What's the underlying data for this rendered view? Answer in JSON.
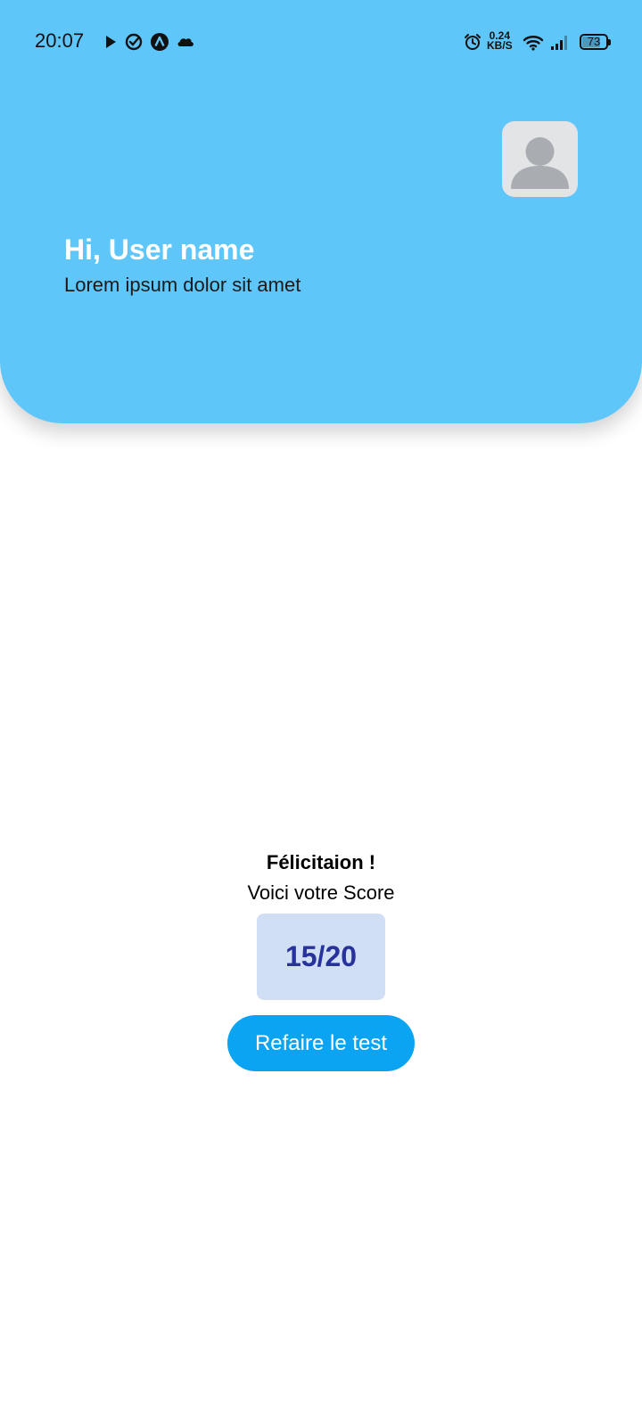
{
  "status_bar": {
    "time": "20:07",
    "network_speed_value": "0.24",
    "network_speed_unit": "KB/S",
    "battery_percent": "73",
    "battery_level": 0.73,
    "left_icons": [
      "play-icon",
      "check-circle-icon",
      "app-a-icon",
      "cloud-icon"
    ],
    "right_icons": [
      "alarm-icon",
      "wifi-icon",
      "signal-icon",
      "battery-icon"
    ]
  },
  "header": {
    "background_color": "#5fc6f9",
    "greeting": "Hi, User name",
    "subtitle": "Lorem ipsum dolor sit amet",
    "avatar_icon": "user-avatar-icon"
  },
  "result": {
    "title": "Félicitaion !",
    "label": "Voici votre Score",
    "score": "15/20",
    "score_color": "#28329b",
    "score_bg": "#d0dff3"
  },
  "retake_button": {
    "label": "Refaire le test",
    "color": "#0aa4f2"
  }
}
